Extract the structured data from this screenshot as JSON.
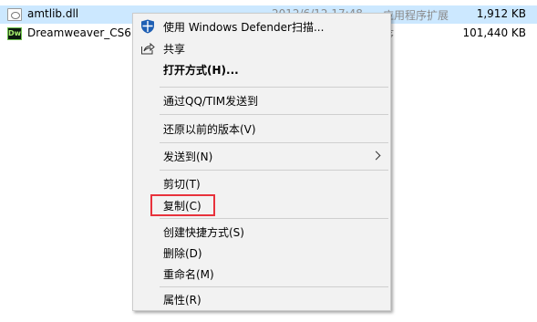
{
  "files": [
    {
      "name": "amtlib.dll",
      "date": "2012/6/12 17:48",
      "type": "应用程序扩展",
      "size": "1,912 KB",
      "icon": "dll-file-icon",
      "selected": true
    },
    {
      "name": "Dreamweaver_CS6P",
      "date": "",
      "type": "序",
      "size": "101,440 KB",
      "icon": "dreamweaver-app-icon",
      "selected": false
    }
  ],
  "menu": {
    "items": [
      {
        "label": "使用 Windows Defender扫描...",
        "icon": "windows-defender-shield-icon"
      },
      {
        "label": "共享",
        "icon": "share-icon"
      },
      {
        "label": "打开方式(H)..."
      },
      {
        "label": "通过QQ/TIM发送到"
      },
      {
        "label": "还原以前的版本(V)"
      },
      {
        "label": "发送到(N)",
        "submenu": true
      },
      {
        "label": "剪切(T)"
      },
      {
        "label": "复制(C)",
        "highlighted": true
      },
      {
        "label": "创建快捷方式(S)"
      },
      {
        "label": "删除(D)"
      },
      {
        "label": "重命名(M)"
      },
      {
        "label": "属性(R)"
      }
    ]
  },
  "colors": {
    "selection": "#cce8ff",
    "menu_background": "#f2f2f2",
    "highlight_box": "#e8323c",
    "defender_blue": "#1e5fb4"
  }
}
